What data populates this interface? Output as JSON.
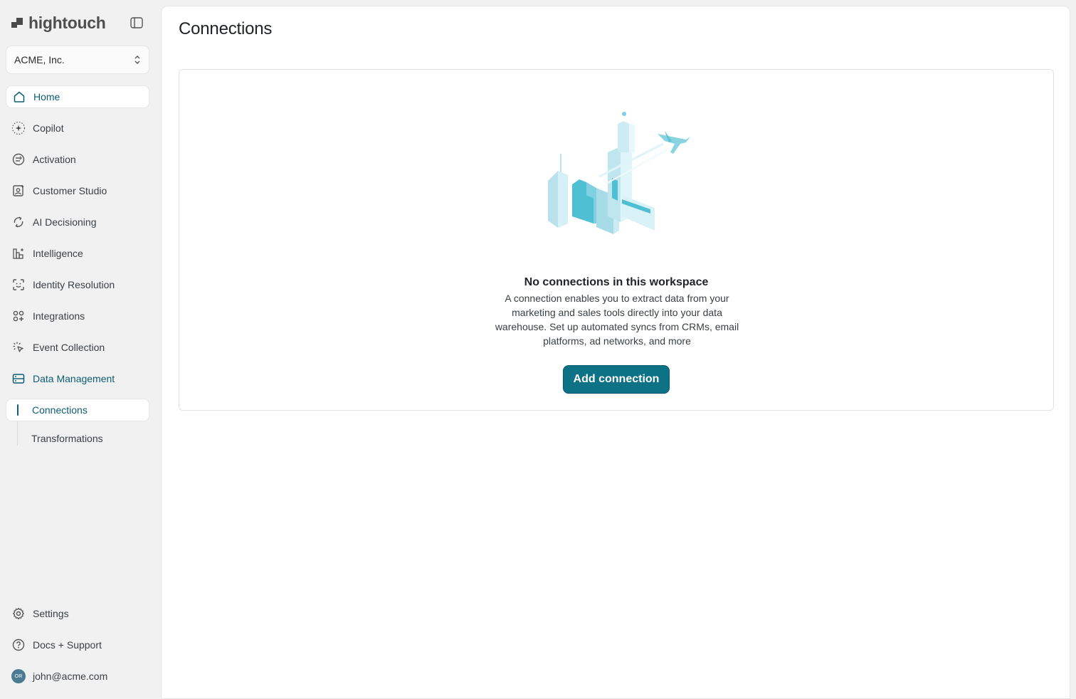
{
  "brand": {
    "name": "hightouch"
  },
  "workspace": {
    "name": "ACME, Inc."
  },
  "nav": {
    "items": [
      {
        "label": "Home",
        "icon": "home-icon"
      },
      {
        "label": "Copilot",
        "icon": "sparkle-icon"
      },
      {
        "label": "Activation",
        "icon": "activation-icon"
      },
      {
        "label": "Customer Studio",
        "icon": "person-card-icon"
      },
      {
        "label": "AI Decisioning",
        "icon": "refresh-arrows-icon"
      },
      {
        "label": "Intelligence",
        "icon": "bar-chart-icon"
      },
      {
        "label": "Identity Resolution",
        "icon": "face-scan-icon"
      },
      {
        "label": "Integrations",
        "icon": "grid-plus-icon"
      },
      {
        "label": "Event Collection",
        "icon": "cursor-click-icon"
      },
      {
        "label": "Data Management",
        "icon": "database-card-icon"
      }
    ],
    "subitems": [
      {
        "label": "Connections"
      },
      {
        "label": "Transformations"
      }
    ],
    "bottom": [
      {
        "label": "Settings",
        "icon": "gear-icon"
      },
      {
        "label": "Docs + Support",
        "icon": "help-circle-icon"
      },
      {
        "label": "john@acme.com",
        "avatar_initials": "OR"
      }
    ]
  },
  "main": {
    "title": "Connections",
    "empty_state": {
      "title": "No connections in this workspace",
      "description": "A connection enables you to extract data from your marketing and sales tools directly into your data warehouse. Set up automated syncs from CRMs, email platforms, ad networks, and more",
      "button_label": "Add connection"
    }
  },
  "colors": {
    "accent": "#0d5d73",
    "button": "#0e7287",
    "sidebar_bg": "#f1f1f1"
  }
}
